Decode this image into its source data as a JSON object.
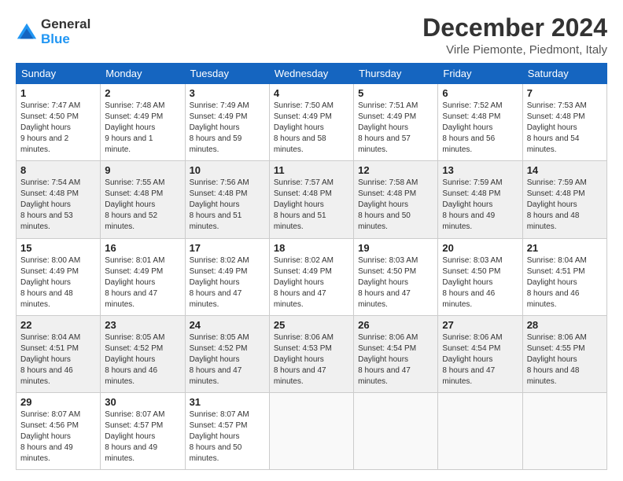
{
  "header": {
    "logo_line1": "General",
    "logo_line2": "Blue",
    "title": "December 2024",
    "location": "Virle Piemonte, Piedmont, Italy"
  },
  "weekdays": [
    "Sunday",
    "Monday",
    "Tuesday",
    "Wednesday",
    "Thursday",
    "Friday",
    "Saturday"
  ],
  "weeks": [
    [
      {
        "day": "1",
        "sunrise": "7:47 AM",
        "sunset": "4:50 PM",
        "daylight": "9 hours and 2 minutes."
      },
      {
        "day": "2",
        "sunrise": "7:48 AM",
        "sunset": "4:49 PM",
        "daylight": "9 hours and 1 minute."
      },
      {
        "day": "3",
        "sunrise": "7:49 AM",
        "sunset": "4:49 PM",
        "daylight": "8 hours and 59 minutes."
      },
      {
        "day": "4",
        "sunrise": "7:50 AM",
        "sunset": "4:49 PM",
        "daylight": "8 hours and 58 minutes."
      },
      {
        "day": "5",
        "sunrise": "7:51 AM",
        "sunset": "4:49 PM",
        "daylight": "8 hours and 57 minutes."
      },
      {
        "day": "6",
        "sunrise": "7:52 AM",
        "sunset": "4:48 PM",
        "daylight": "8 hours and 56 minutes."
      },
      {
        "day": "7",
        "sunrise": "7:53 AM",
        "sunset": "4:48 PM",
        "daylight": "8 hours and 54 minutes."
      }
    ],
    [
      {
        "day": "8",
        "sunrise": "7:54 AM",
        "sunset": "4:48 PM",
        "daylight": "8 hours and 53 minutes."
      },
      {
        "day": "9",
        "sunrise": "7:55 AM",
        "sunset": "4:48 PM",
        "daylight": "8 hours and 52 minutes."
      },
      {
        "day": "10",
        "sunrise": "7:56 AM",
        "sunset": "4:48 PM",
        "daylight": "8 hours and 51 minutes."
      },
      {
        "day": "11",
        "sunrise": "7:57 AM",
        "sunset": "4:48 PM",
        "daylight": "8 hours and 51 minutes."
      },
      {
        "day": "12",
        "sunrise": "7:58 AM",
        "sunset": "4:48 PM",
        "daylight": "8 hours and 50 minutes."
      },
      {
        "day": "13",
        "sunrise": "7:59 AM",
        "sunset": "4:48 PM",
        "daylight": "8 hours and 49 minutes."
      },
      {
        "day": "14",
        "sunrise": "7:59 AM",
        "sunset": "4:48 PM",
        "daylight": "8 hours and 48 minutes."
      }
    ],
    [
      {
        "day": "15",
        "sunrise": "8:00 AM",
        "sunset": "4:49 PM",
        "daylight": "8 hours and 48 minutes."
      },
      {
        "day": "16",
        "sunrise": "8:01 AM",
        "sunset": "4:49 PM",
        "daylight": "8 hours and 47 minutes."
      },
      {
        "day": "17",
        "sunrise": "8:02 AM",
        "sunset": "4:49 PM",
        "daylight": "8 hours and 47 minutes."
      },
      {
        "day": "18",
        "sunrise": "8:02 AM",
        "sunset": "4:49 PM",
        "daylight": "8 hours and 47 minutes."
      },
      {
        "day": "19",
        "sunrise": "8:03 AM",
        "sunset": "4:50 PM",
        "daylight": "8 hours and 47 minutes."
      },
      {
        "day": "20",
        "sunrise": "8:03 AM",
        "sunset": "4:50 PM",
        "daylight": "8 hours and 46 minutes."
      },
      {
        "day": "21",
        "sunrise": "8:04 AM",
        "sunset": "4:51 PM",
        "daylight": "8 hours and 46 minutes."
      }
    ],
    [
      {
        "day": "22",
        "sunrise": "8:04 AM",
        "sunset": "4:51 PM",
        "daylight": "8 hours and 46 minutes."
      },
      {
        "day": "23",
        "sunrise": "8:05 AM",
        "sunset": "4:52 PM",
        "daylight": "8 hours and 46 minutes."
      },
      {
        "day": "24",
        "sunrise": "8:05 AM",
        "sunset": "4:52 PM",
        "daylight": "8 hours and 47 minutes."
      },
      {
        "day": "25",
        "sunrise": "8:06 AM",
        "sunset": "4:53 PM",
        "daylight": "8 hours and 47 minutes."
      },
      {
        "day": "26",
        "sunrise": "8:06 AM",
        "sunset": "4:54 PM",
        "daylight": "8 hours and 47 minutes."
      },
      {
        "day": "27",
        "sunrise": "8:06 AM",
        "sunset": "4:54 PM",
        "daylight": "8 hours and 47 minutes."
      },
      {
        "day": "28",
        "sunrise": "8:06 AM",
        "sunset": "4:55 PM",
        "daylight": "8 hours and 48 minutes."
      }
    ],
    [
      {
        "day": "29",
        "sunrise": "8:07 AM",
        "sunset": "4:56 PM",
        "daylight": "8 hours and 49 minutes."
      },
      {
        "day": "30",
        "sunrise": "8:07 AM",
        "sunset": "4:57 PM",
        "daylight": "8 hours and 49 minutes."
      },
      {
        "day": "31",
        "sunrise": "8:07 AM",
        "sunset": "4:57 PM",
        "daylight": "8 hours and 50 minutes."
      },
      null,
      null,
      null,
      null
    ]
  ]
}
